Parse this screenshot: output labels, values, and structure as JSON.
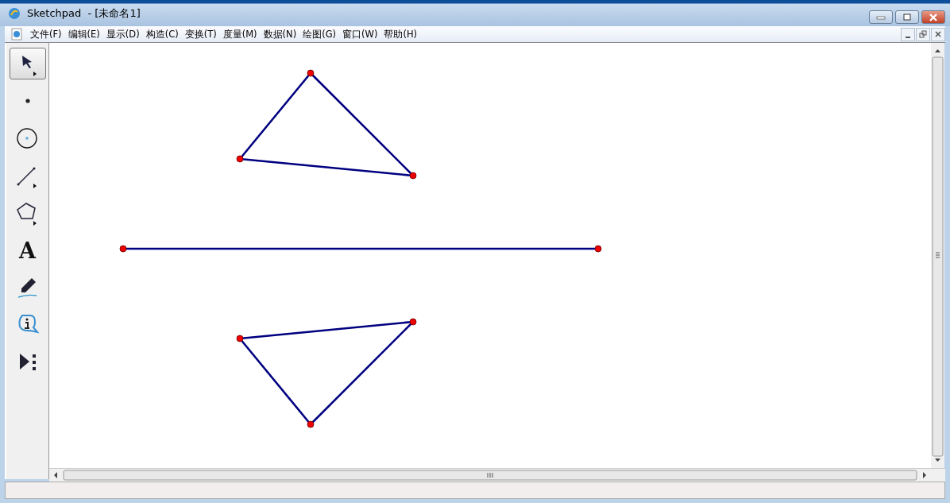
{
  "window": {
    "title": "Sketchpad  - [未命名1]"
  },
  "menu": [
    "文件(F)",
    "编辑(E)",
    "显示(D)",
    "构造(C)",
    "变换(T)",
    "度量(M)",
    "数据(N)",
    "绘图(G)",
    "窗口(W)",
    "帮助(H)"
  ],
  "tools": [
    {
      "kind": "arrow",
      "selected": true
    },
    {
      "kind": "point",
      "selected": false
    },
    {
      "kind": "compass",
      "selected": false
    },
    {
      "kind": "line",
      "selected": false
    },
    {
      "kind": "polygon",
      "selected": false
    },
    {
      "kind": "text",
      "glyph": "A",
      "selected": false
    },
    {
      "kind": "marker",
      "selected": false
    },
    {
      "kind": "info",
      "selected": false
    },
    {
      "kind": "custom",
      "selected": false
    }
  ]
}
